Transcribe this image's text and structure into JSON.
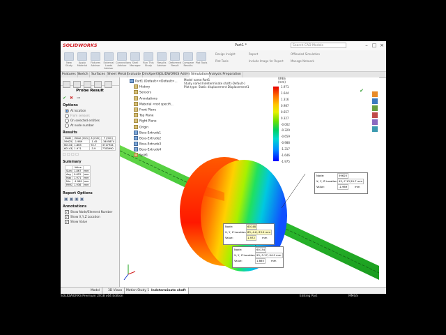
{
  "app": {
    "logo": "SOLIDWORKS",
    "doc_title": "Part1 *",
    "search_placeholder": "Search CAD Models",
    "min": "–",
    "max": "□",
    "close": "×"
  },
  "ribbon": {
    "buttons": [
      "New Study",
      "Apply Material",
      "Fixtures Advisor",
      "External Loads Advisor",
      "Connections Advisor",
      "Shell Manager",
      "Run This Study",
      "Results Advisor",
      "Deformed Result",
      "Compare Results",
      "Plot Tools"
    ],
    "small": [
      "Design Insight",
      "Plot Tools",
      "Report",
      "Include Image for Report",
      "Offloaded Simulation",
      "Manage Network"
    ]
  },
  "tabs": [
    "Features",
    "Sketch",
    "Surfaces",
    "Sheet Metal",
    "Evaluate",
    "DimXpert",
    "SOLIDWORKS Add-Ins",
    "Simulation",
    "Analysis Preparation"
  ],
  "active_tab": "Simulation",
  "panel": {
    "title": "Probe Result",
    "options_title": "Options",
    "options": [
      {
        "label": "At location",
        "on": true,
        "dim": false
      },
      {
        "label": "From sensors",
        "on": false,
        "dim": true
      },
      {
        "label": "On selected entities",
        "on": false,
        "dim": false
      },
      {
        "label": "At node number",
        "on": false,
        "dim": false
      }
    ],
    "results_title": "Results",
    "results_headers": [
      "Node",
      "Value (mm)",
      "X (mm)",
      "Y (mm)"
    ],
    "results_rows": [
      [
        "59625",
        "-1.989",
        "-1.45",
        "-3405874"
      ],
      [
        "60134",
        "1.865",
        "92.7",
        "3717944"
      ],
      [
        "60143",
        "1.971",
        "-3.9",
        "7783990"
      ]
    ],
    "summary_title": "Summary",
    "summary_headers": [
      "",
      "Value",
      ""
    ],
    "summary_rows": [
      [
        "Sum",
        "1.867",
        "mm"
      ],
      [
        "Avg",
        "0.622",
        "mm"
      ],
      [
        "Max",
        "1.971",
        "mm"
      ],
      [
        "Min",
        "-1.969",
        "mm"
      ],
      [
        "RMS",
        "1.936",
        "mm"
      ]
    ],
    "report_title": "Report Options",
    "annotations_title": "Annotations",
    "annotations": [
      "Show Node/Element Number",
      "Show X,Y,Z Location",
      "Show Value"
    ]
  },
  "tree": {
    "part": "Part1 (Default<<Default>...",
    "items": [
      {
        "label": "History",
        "blue": false
      },
      {
        "label": "Sensors",
        "blue": false
      },
      {
        "label": "Annotations",
        "blue": false
      },
      {
        "label": "Material <not specifi...",
        "blue": false
      },
      {
        "label": "Front Plane",
        "blue": false
      },
      {
        "label": "Top Plane",
        "blue": false
      },
      {
        "label": "Right Plane",
        "blue": false
      },
      {
        "label": "Origin",
        "blue": false
      },
      {
        "label": "Boss-Extrude1",
        "blue": true
      },
      {
        "label": "Boss-Extrude2",
        "blue": true
      },
      {
        "label": "Boss-Extrude3",
        "blue": true
      },
      {
        "label": "Boss-Extrude4",
        "blue": true
      },
      {
        "label": "Split1",
        "blue": false
      }
    ]
  },
  "view_header": [
    "Model name:Part1",
    "Study name:Indeterminate shaft(-Default-)",
    "Plot type: Static displacement Displacement1"
  ],
  "callouts": [
    {
      "node": "59625",
      "loc": "93,-7.13,59.7 mm",
      "value": "-1.969"
    },
    {
      "node": "60148",
      "loc": "83,-4.6,-33.9 mm",
      "value": "1.972"
    },
    {
      "node": "60134",
      "loc": "93,-3.17,-94.0 mm",
      "value": "1.865"
    }
  ],
  "callout_labels": {
    "node": "Node:",
    "loc": "X, Y, Z Location:",
    "value": "Value:",
    "unit": "mm"
  },
  "legend": {
    "unit": "URES (mm)",
    "ticks": [
      "1.971",
      "1.644",
      "1.316",
      "0.987",
      "0.657",
      "0.327",
      "-0.002",
      "-0.329",
      "-0.659",
      "-0.988",
      "-1.317",
      "-1.646",
      "-1.975"
    ]
  },
  "bottom_tabs": [
    "Model",
    "3D Views",
    "Motion Study 1",
    "Indeterminate shaft"
  ],
  "status": {
    "edition": "SOLIDWORKS Premium 2018 x64 Edition",
    "editing": "Editing Part",
    "units": "MMGS"
  },
  "colors": {
    "brand": "#d31f26",
    "accent": "#1a5fb4"
  }
}
